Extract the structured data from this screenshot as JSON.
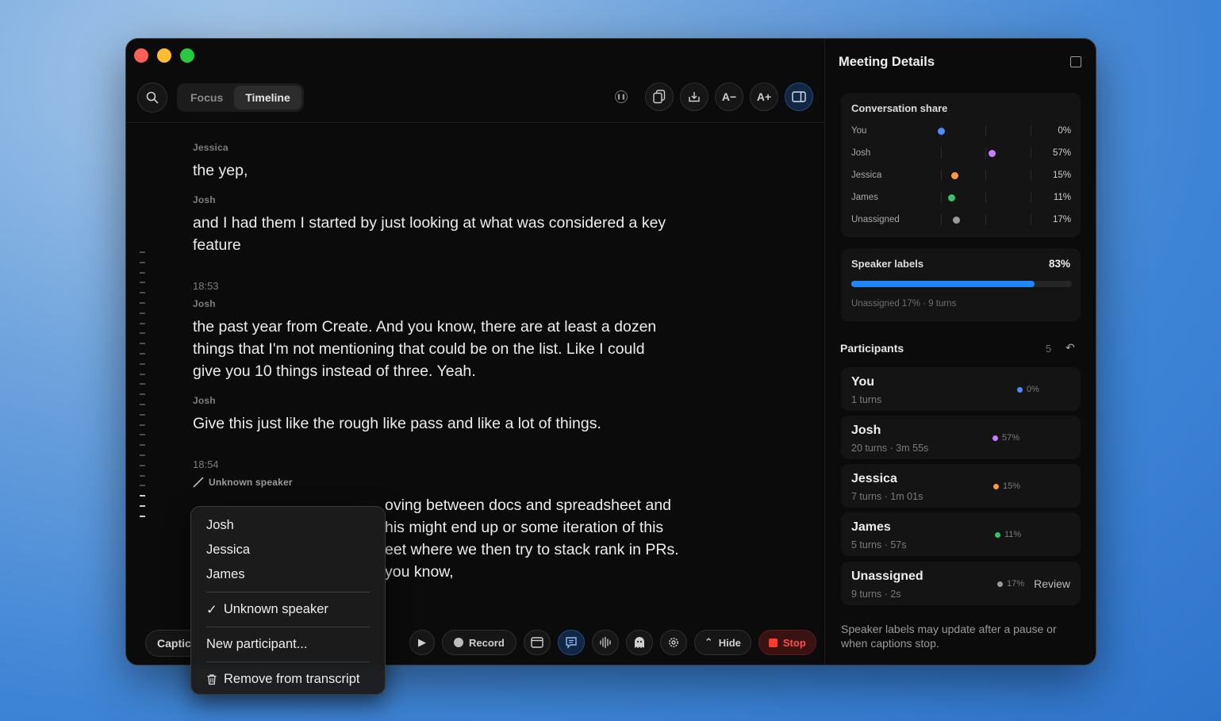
{
  "colors": {
    "accent": "#1f86ff",
    "stop": "#ff3b30",
    "you": "#4f8cff",
    "josh": "#c77dff",
    "jessica": "#ff9a3c",
    "james": "#35c46b",
    "unassigned": "#9a9a9a"
  },
  "toolbar": {
    "tabs": [
      "Focus",
      "Timeline"
    ],
    "active_tab": "Timeline",
    "font_decrease": "A−",
    "font_increase": "A+",
    "icons": [
      "search-icon",
      "pause-icon",
      "copy-icon",
      "download-icon",
      "sidebar-toggle-icon"
    ]
  },
  "transcript": {
    "blocks": [
      {
        "speaker": "Jessica",
        "text": "the yep,"
      },
      {
        "speaker": "Josh",
        "text": "and I had them I started by just looking at what was considered a key feature"
      },
      {
        "time": "18:53",
        "speaker": "Josh",
        "text": "the past year from Create. And you know, there are at least a dozen things that I'm not mentioning that could be on the list. Like I could give you 10 things instead of three. Yeah."
      },
      {
        "speaker": "Josh",
        "text": "Give this just like the rough like pass and like a lot of things."
      },
      {
        "time": "18:54",
        "speaker": "Unknown speaker",
        "lines": [
          "oving between docs and spreadsheet and",
          "his might end up or some iteration of this",
          "eet where we then try to stack rank in PRs.",
          "you know,"
        ]
      }
    ]
  },
  "menu": {
    "speakers": [
      "Josh",
      "Jessica",
      "James"
    ],
    "selected": "Unknown speaker",
    "new_participant": "New participant...",
    "remove": "Remove from transcript"
  },
  "bottombar": {
    "captions": "Captic",
    "record": "Record",
    "hide": "Hide",
    "stop": "Stop"
  },
  "sidebar": {
    "title": "Meeting Details",
    "conversation_share": {
      "title": "Conversation share",
      "rows": [
        {
          "name": "You",
          "pct": "0%"
        },
        {
          "name": "Josh",
          "pct": "57%"
        },
        {
          "name": "Jessica",
          "pct": "15%"
        },
        {
          "name": "James",
          "pct": "11%"
        },
        {
          "name": "Unassigned",
          "pct": "17%"
        }
      ]
    },
    "speaker_labels": {
      "title": "Speaker labels",
      "pct": "83%",
      "fill": 0.83,
      "note": "Unassigned 17% · 9 turns"
    },
    "participants": {
      "title": "Participants",
      "count": "5",
      "items": [
        {
          "name": "You",
          "detail": "1 turns",
          "pct": "0%"
        },
        {
          "name": "Josh",
          "detail": "20 turns · 3m 55s",
          "pct": "57%"
        },
        {
          "name": "Jessica",
          "detail": "7 turns · 1m 01s",
          "pct": "15%"
        },
        {
          "name": "James",
          "detail": "5 turns · 57s",
          "pct": "11%"
        },
        {
          "name": "Unassigned",
          "detail": "9 turns · 2s",
          "pct": "17%",
          "action": "Review"
        }
      ]
    },
    "note": "Speaker labels may update after a pause or when captions stop."
  }
}
